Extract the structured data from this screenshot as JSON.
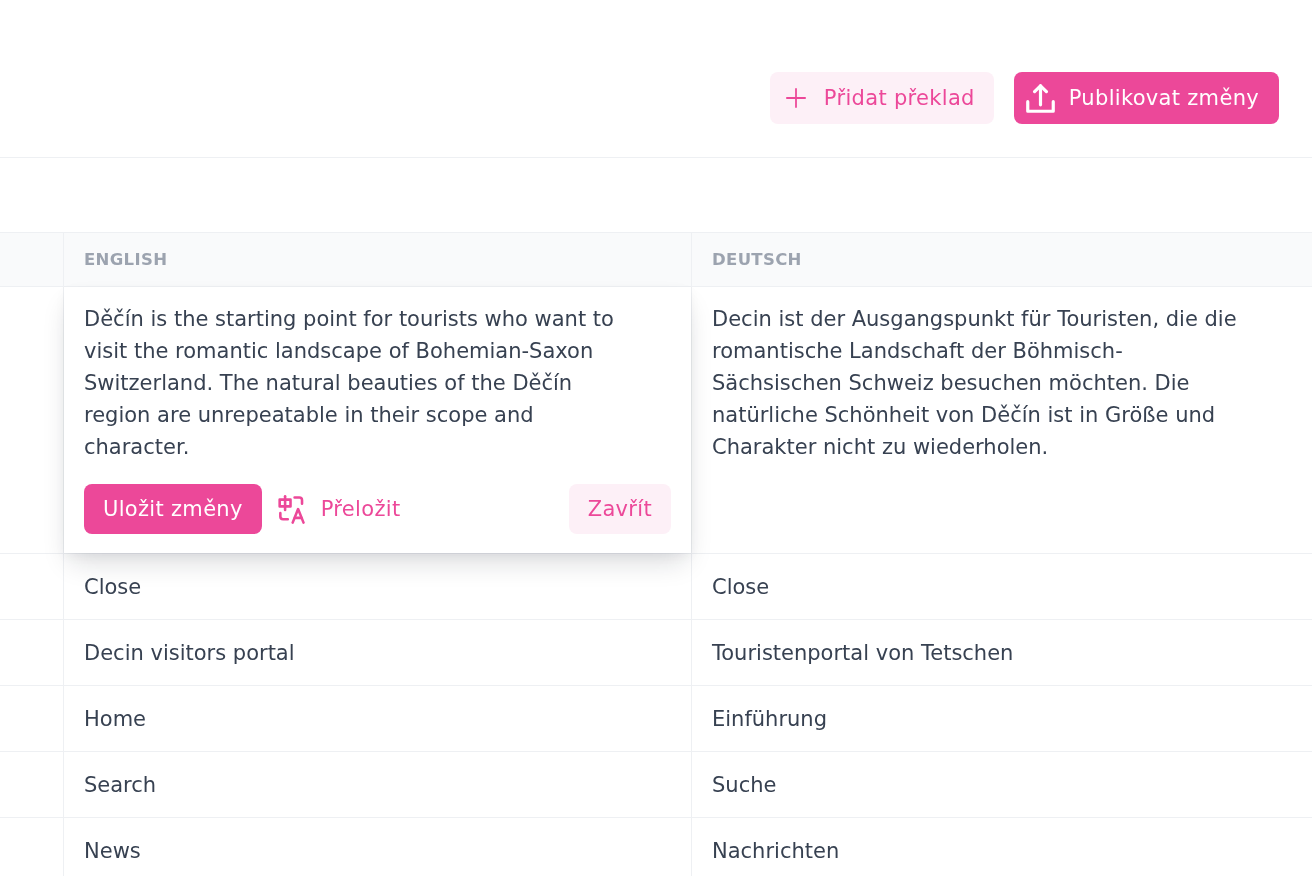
{
  "toolbar": {
    "buttons": [
      {
        "kind": "add",
        "label": "Přidat překlad"
      },
      {
        "kind": "publish",
        "label": "Publikovat změny"
      }
    ]
  },
  "table": {
    "columns": [
      "ENGLISH",
      "DEUTSCH"
    ],
    "editor_actions": [
      {
        "kind": "save",
        "label": "Uložit změny"
      },
      {
        "kind": "translate",
        "label": "Přeložit"
      },
      {
        "kind": "close",
        "label": "Zavřít"
      }
    ],
    "rows": [
      {
        "editing": true,
        "cells": [
          "Děčín is the starting point for tourists who want to visit the romantic landscape of Bohemian-Saxon Switzerland. The natural beauties of the Děčín region are unrepeatable in their scope and character.",
          "Decin ist der Ausgangspunkt für Touristen, die die romantische Landschaft der Böhmisch-Sächsischen Schweiz besuchen möchten. Die natürliche Schönheit von Děčín ist in Größe und Charakter nicht zu wiederholen."
        ]
      },
      {
        "editing": false,
        "cells": [
          "Close",
          "Close"
        ]
      },
      {
        "editing": false,
        "cells": [
          "Decin visitors portal",
          "Touristenportal von Tetschen"
        ]
      },
      {
        "editing": false,
        "cells": [
          "Home",
          "Einführung"
        ]
      },
      {
        "editing": false,
        "cells": [
          "Search",
          "Suche"
        ]
      },
      {
        "editing": false,
        "cells": [
          "News",
          "Nachrichten"
        ]
      }
    ]
  }
}
